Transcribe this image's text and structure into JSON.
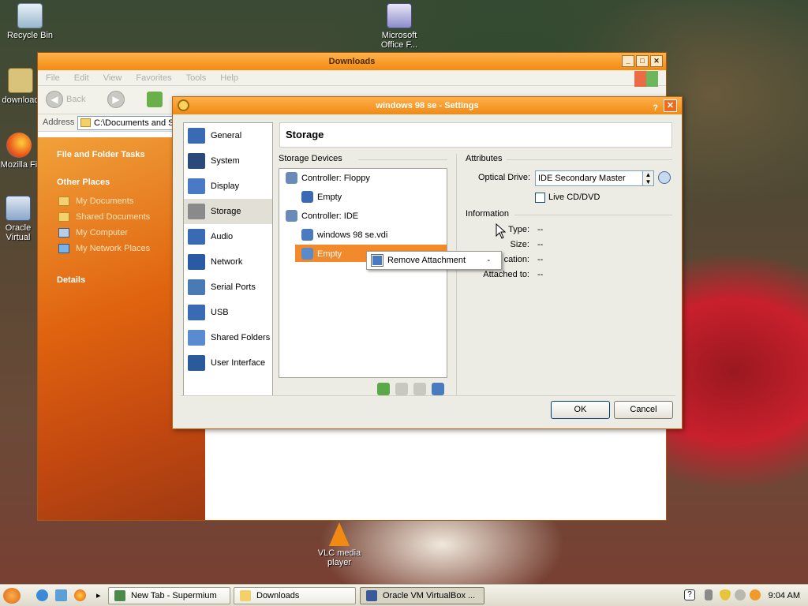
{
  "desktop": {
    "icons": [
      {
        "label": "Recycle Bin",
        "icon": "recycle-bin-icon"
      },
      {
        "label": "download",
        "icon": "download-folder-icon"
      },
      {
        "label": "Mozilla Fi",
        "icon": "firefox-icon"
      },
      {
        "label": "Oracle Virtual",
        "icon": "virtualbox-icon"
      },
      {
        "label": "Microsoft Office F...",
        "icon": "office-shortcut-icon"
      },
      {
        "label": "VLC media player",
        "icon": "vlc-icon"
      }
    ]
  },
  "explorer": {
    "title": "Downloads",
    "menu": [
      "File",
      "Edit",
      "View",
      "Favorites",
      "Tools",
      "Help"
    ],
    "back_label": "Back",
    "address_label": "Address",
    "address_value": "C:\\Documents and S",
    "tasks_header": "File and Folder Tasks",
    "other_places_header": "Other Places",
    "other_places": [
      "My Documents",
      "Shared Documents",
      "My Computer",
      "My Network Places"
    ],
    "details_header": "Details"
  },
  "dialog": {
    "title": "windows 98 se - Settings",
    "help": "?",
    "close": "✕",
    "categories": [
      {
        "label": "General",
        "icon": "general-icon",
        "color": "#3a6ab4"
      },
      {
        "label": "System",
        "icon": "system-chip-icon",
        "color": "#2a4a7a"
      },
      {
        "label": "Display",
        "icon": "display-icon",
        "color": "#4a7ac6"
      },
      {
        "label": "Storage",
        "icon": "storage-disk-icon",
        "color": "#8a8a8a"
      },
      {
        "label": "Audio",
        "icon": "audio-speaker-icon",
        "color": "#3a6ab4"
      },
      {
        "label": "Network",
        "icon": "network-icon",
        "color": "#2a5aa4"
      },
      {
        "label": "Serial Ports",
        "icon": "serial-port-icon",
        "color": "#4a7ab4"
      },
      {
        "label": "USB",
        "icon": "usb-icon",
        "color": "#3a6ab4"
      },
      {
        "label": "Shared Folders",
        "icon": "shared-folder-icon",
        "color": "#5a8ad0"
      },
      {
        "label": "User Interface",
        "icon": "user-interface-icon",
        "color": "#2a5a9a"
      }
    ],
    "selected_category": "Storage",
    "section_title": "Storage",
    "storage_devices_label": "Storage Devices",
    "tree": [
      {
        "label": "Controller: Floppy",
        "level": 0,
        "icon": "floppy-controller-icon"
      },
      {
        "label": "Empty",
        "level": 1,
        "icon": "floppy-disk-icon"
      },
      {
        "label": "Controller: IDE",
        "level": 0,
        "icon": "ide-controller-icon"
      },
      {
        "label": "windows 98 se.vdi",
        "level": 1,
        "icon": "hard-disk-icon"
      },
      {
        "label": "Empty",
        "level": 1,
        "icon": "optical-disc-icon",
        "selected": true
      }
    ],
    "context_menu": {
      "item": "Remove Attachment",
      "shortcut": "-"
    },
    "attributes_label": "Attributes",
    "optical_drive_label": "Optical Drive:",
    "optical_drive_value": "IDE Secondary Master",
    "live_cd_label": "Live CD/DVD",
    "information_label": "Information",
    "info_rows": [
      {
        "key": "Type:",
        "value": "--"
      },
      {
        "key": "Size:",
        "value": "--"
      },
      {
        "key": "cation:",
        "value": "--"
      },
      {
        "key": "Attached to:",
        "value": "--"
      }
    ],
    "ok": "OK",
    "cancel": "Cancel"
  },
  "taskbar": {
    "tasks": [
      {
        "label": "New Tab - Supermium",
        "icon": "supermium-icon",
        "active": false
      },
      {
        "label": "Downloads",
        "icon": "folder-icon",
        "active": false
      },
      {
        "label": "Oracle VM VirtualBox ...",
        "icon": "virtualbox-icon",
        "active": true
      }
    ],
    "clock": "9:04 AM",
    "expand": "▸"
  }
}
